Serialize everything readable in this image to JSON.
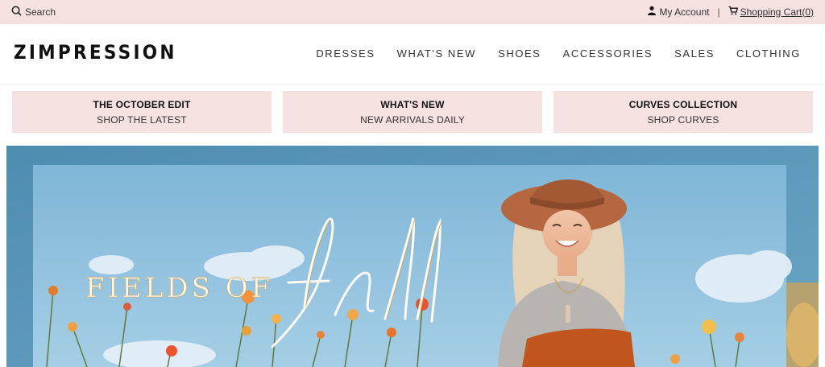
{
  "topbar": {
    "search_label": "Search",
    "account_label": "My Account",
    "separator": "|",
    "cart_label": "Shopping Cart(0)"
  },
  "header": {
    "logo": "ZIMPRESSION",
    "nav": [
      "DRESSES",
      "WHAT'S NEW",
      "SHOES",
      "ACCESSORIES",
      "SALES",
      "CLOTHING"
    ]
  },
  "promos": [
    {
      "title": "THE OCTOBER EDIT",
      "subtitle": "SHOP THE LATEST"
    },
    {
      "title": "WHAT'S NEW",
      "subtitle": "NEW ARRIVALS DAILY"
    },
    {
      "title": "CURVES COLLECTION",
      "subtitle": "SHOP CURVES"
    }
  ],
  "hero": {
    "headline": "FIELDS OF",
    "script_word": "fall"
  },
  "colors": {
    "topbar_bg": "#f6e1e1",
    "tile_bg": "#f6e1e1",
    "sky": "#8fc0dd",
    "frame": "#5d97b7",
    "hat": "#b5683f",
    "sweater_orange": "#c0561e"
  },
  "icons": {
    "search": "search-icon",
    "account": "user-icon",
    "cart": "cart-icon"
  }
}
